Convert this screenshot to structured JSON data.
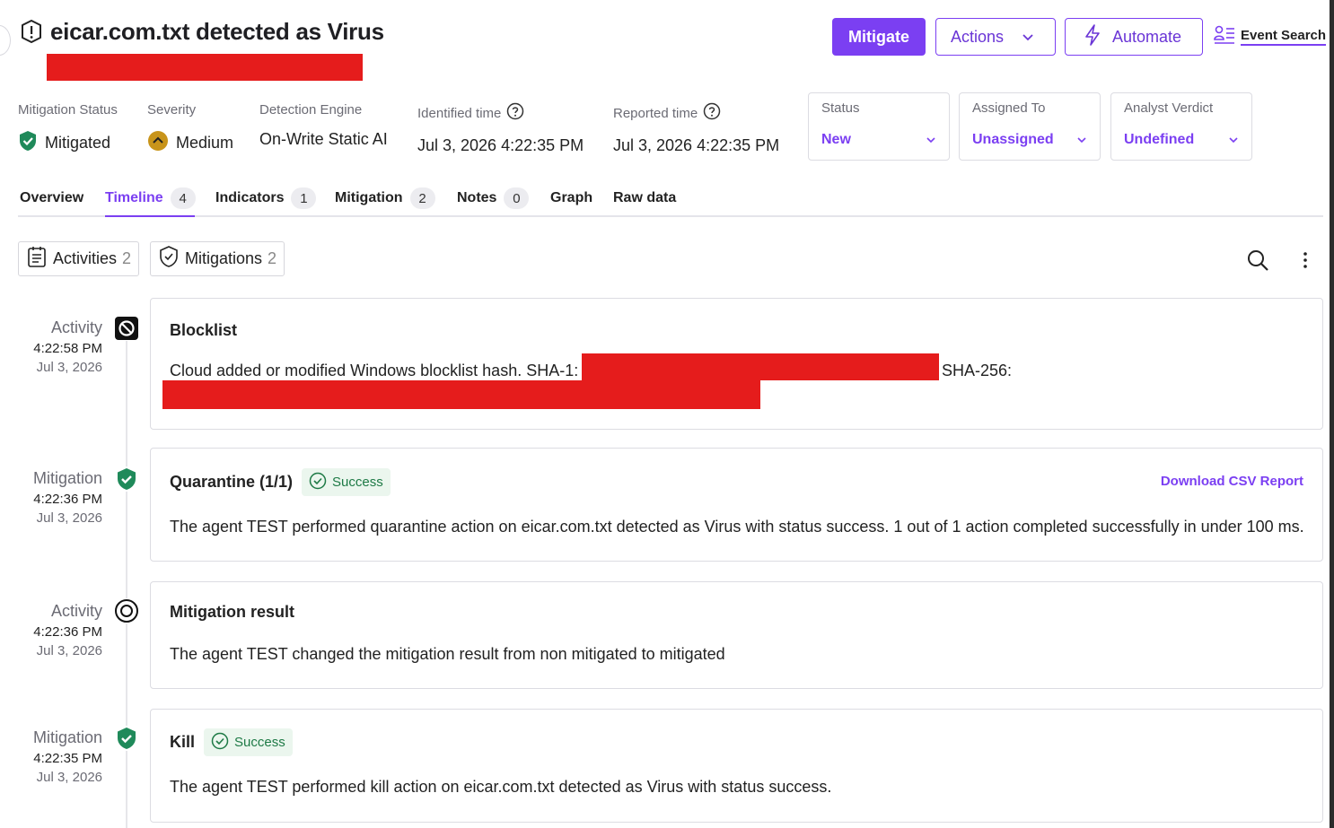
{
  "header": {
    "title": "eicar.com.txt detected as Virus",
    "buttons": {
      "mitigate": "Mitigate",
      "actions": "Actions",
      "automate": "Automate",
      "event_search": "Event Search"
    }
  },
  "meta": {
    "mitigation_status": {
      "label": "Mitigation Status",
      "value": "Mitigated"
    },
    "severity": {
      "label": "Severity",
      "value": "Medium"
    },
    "detection_engine": {
      "label": "Detection Engine",
      "value": "On-Write Static AI"
    },
    "identified_time": {
      "label": "Identified time",
      "value": "Jul 3, 2026 4:22:35 PM"
    },
    "reported_time": {
      "label": "Reported time",
      "value": "Jul 3, 2026 4:22:35 PM"
    }
  },
  "dropdowns": {
    "status": {
      "label": "Status",
      "value": "New"
    },
    "assigned_to": {
      "label": "Assigned To",
      "value": "Unassigned"
    },
    "analyst_verdict": {
      "label": "Analyst Verdict",
      "value": "Undefined"
    }
  },
  "tabs": [
    {
      "label": "Overview",
      "count": null
    },
    {
      "label": "Timeline",
      "count": "4"
    },
    {
      "label": "Indicators",
      "count": "1"
    },
    {
      "label": "Mitigation",
      "count": "2"
    },
    {
      "label": "Notes",
      "count": "0"
    },
    {
      "label": "Graph",
      "count": null
    },
    {
      "label": "Raw data",
      "count": null
    }
  ],
  "filters": {
    "activities": {
      "label": "Activities",
      "count": "2"
    },
    "mitigations": {
      "label": "Mitigations",
      "count": "2"
    }
  },
  "timeline": [
    {
      "kind": "Activity",
      "time": "4:22:58 PM",
      "date": "Jul 3, 2026",
      "title": "Blocklist",
      "body_prefix": "Cloud added or modified Windows blocklist hash. SHA-1:",
      "body_mid": "SHA-256:"
    },
    {
      "kind": "Mitigation",
      "time": "4:22:36 PM",
      "date": "Jul 3, 2026",
      "title": "Quarantine (1/1)",
      "status": "Success",
      "link": "Download CSV Report",
      "body": "The agent TEST performed quarantine action on eicar.com.txt detected as Virus with status success. 1 out of 1 action completed successfully in under 100 ms."
    },
    {
      "kind": "Activity",
      "time": "4:22:36 PM",
      "date": "Jul 3, 2026",
      "title": "Mitigation result",
      "body": "The agent TEST changed the mitigation result from non mitigated to mitigated"
    },
    {
      "kind": "Mitigation",
      "time": "4:22:35 PM",
      "date": "Jul 3, 2026",
      "title": "Kill",
      "status": "Success",
      "body": "The agent TEST performed kill action on eicar.com.txt detected as Virus with status success."
    }
  ],
  "colors": {
    "accent": "#7b3ff2",
    "success": "#1e7a46",
    "success_bg": "#ebf6ee",
    "severity_medium": "#c8941a",
    "mitigated_green": "#1f8a5a",
    "redaction": "#e51c1c"
  }
}
